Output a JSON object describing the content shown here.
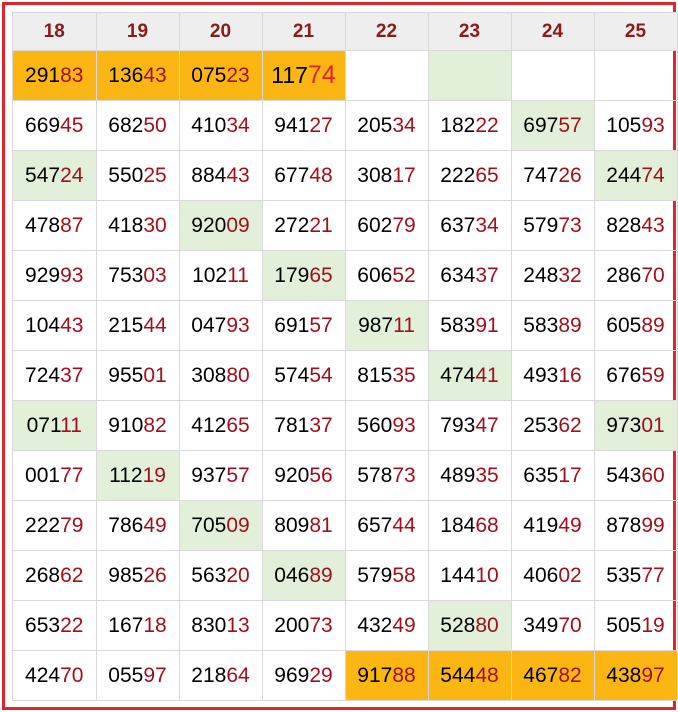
{
  "headers": [
    "18",
    "19",
    "20",
    "21",
    "22",
    "23",
    "24",
    "25"
  ],
  "colors": {
    "frame": "#e0242e",
    "header_text": "#8b1a1a",
    "highlight_green": "#e2f0d9",
    "highlight_orange": "#fbb614",
    "digits_tail": "#a0101c"
  },
  "rows": [
    [
      {
        "v": "29183",
        "bg": "orange"
      },
      {
        "v": "13643",
        "bg": "orange"
      },
      {
        "v": "07523",
        "bg": "orange"
      },
      {
        "v": "11774",
        "bg": "orange",
        "emph": true
      },
      {
        "v": "",
        "bg": ""
      },
      {
        "v": "",
        "bg": "green"
      },
      {
        "v": "",
        "bg": ""
      },
      {
        "v": "",
        "bg": ""
      }
    ],
    [
      {
        "v": "66945",
        "bg": ""
      },
      {
        "v": "68250",
        "bg": ""
      },
      {
        "v": "41034",
        "bg": ""
      },
      {
        "v": "94127",
        "bg": ""
      },
      {
        "v": "20534",
        "bg": ""
      },
      {
        "v": "18222",
        "bg": ""
      },
      {
        "v": "69757",
        "bg": "green"
      },
      {
        "v": "10593",
        "bg": ""
      }
    ],
    [
      {
        "v": "54724",
        "bg": "green"
      },
      {
        "v": "55025",
        "bg": ""
      },
      {
        "v": "88443",
        "bg": ""
      },
      {
        "v": "67748",
        "bg": ""
      },
      {
        "v": "30817",
        "bg": ""
      },
      {
        "v": "22265",
        "bg": ""
      },
      {
        "v": "74726",
        "bg": ""
      },
      {
        "v": "24474",
        "bg": "green"
      }
    ],
    [
      {
        "v": "47887",
        "bg": ""
      },
      {
        "v": "41830",
        "bg": ""
      },
      {
        "v": "92009",
        "bg": "green"
      },
      {
        "v": "27221",
        "bg": ""
      },
      {
        "v": "60279",
        "bg": ""
      },
      {
        "v": "63734",
        "bg": ""
      },
      {
        "v": "57973",
        "bg": ""
      },
      {
        "v": "82843",
        "bg": ""
      }
    ],
    [
      {
        "v": "92993",
        "bg": ""
      },
      {
        "v": "75303",
        "bg": ""
      },
      {
        "v": "10211",
        "bg": ""
      },
      {
        "v": "17965",
        "bg": "green"
      },
      {
        "v": "60652",
        "bg": ""
      },
      {
        "v": "63437",
        "bg": ""
      },
      {
        "v": "24832",
        "bg": ""
      },
      {
        "v": "28670",
        "bg": ""
      }
    ],
    [
      {
        "v": "10443",
        "bg": ""
      },
      {
        "v": "21544",
        "bg": ""
      },
      {
        "v": "04793",
        "bg": ""
      },
      {
        "v": "69157",
        "bg": ""
      },
      {
        "v": "98711",
        "bg": "green"
      },
      {
        "v": "58391",
        "bg": ""
      },
      {
        "v": "58389",
        "bg": ""
      },
      {
        "v": "60589",
        "bg": ""
      }
    ],
    [
      {
        "v": "72437",
        "bg": ""
      },
      {
        "v": "95501",
        "bg": ""
      },
      {
        "v": "30880",
        "bg": ""
      },
      {
        "v": "57454",
        "bg": ""
      },
      {
        "v": "81535",
        "bg": ""
      },
      {
        "v": "47441",
        "bg": "green"
      },
      {
        "v": "49316",
        "bg": ""
      },
      {
        "v": "67659",
        "bg": ""
      }
    ],
    [
      {
        "v": "07111",
        "bg": "green"
      },
      {
        "v": "91082",
        "bg": ""
      },
      {
        "v": "41265",
        "bg": ""
      },
      {
        "v": "78137",
        "bg": ""
      },
      {
        "v": "56093",
        "bg": ""
      },
      {
        "v": "79347",
        "bg": ""
      },
      {
        "v": "25362",
        "bg": ""
      },
      {
        "v": "97301",
        "bg": "green"
      }
    ],
    [
      {
        "v": "00177",
        "bg": ""
      },
      {
        "v": "11219",
        "bg": "green"
      },
      {
        "v": "93757",
        "bg": ""
      },
      {
        "v": "92056",
        "bg": ""
      },
      {
        "v": "57873",
        "bg": ""
      },
      {
        "v": "48935",
        "bg": ""
      },
      {
        "v": "63517",
        "bg": ""
      },
      {
        "v": "54360",
        "bg": ""
      }
    ],
    [
      {
        "v": "22279",
        "bg": ""
      },
      {
        "v": "78649",
        "bg": ""
      },
      {
        "v": "70509",
        "bg": "green"
      },
      {
        "v": "80981",
        "bg": ""
      },
      {
        "v": "65744",
        "bg": ""
      },
      {
        "v": "18468",
        "bg": ""
      },
      {
        "v": "41949",
        "bg": ""
      },
      {
        "v": "87899",
        "bg": ""
      }
    ],
    [
      {
        "v": "26862",
        "bg": ""
      },
      {
        "v": "98526",
        "bg": ""
      },
      {
        "v": "56320",
        "bg": ""
      },
      {
        "v": "04689",
        "bg": "green"
      },
      {
        "v": "57958",
        "bg": ""
      },
      {
        "v": "14410",
        "bg": ""
      },
      {
        "v": "40602",
        "bg": ""
      },
      {
        "v": "53577",
        "bg": ""
      }
    ],
    [
      {
        "v": "65322",
        "bg": ""
      },
      {
        "v": "16718",
        "bg": ""
      },
      {
        "v": "83013",
        "bg": ""
      },
      {
        "v": "20073",
        "bg": ""
      },
      {
        "v": "43249",
        "bg": ""
      },
      {
        "v": "52880",
        "bg": "green"
      },
      {
        "v": "34970",
        "bg": ""
      },
      {
        "v": "50519",
        "bg": ""
      }
    ],
    [
      {
        "v": "42470",
        "bg": ""
      },
      {
        "v": "05597",
        "bg": ""
      },
      {
        "v": "21864",
        "bg": ""
      },
      {
        "v": "96929",
        "bg": ""
      },
      {
        "v": "91788",
        "bg": "orange"
      },
      {
        "v": "54448",
        "bg": "orange"
      },
      {
        "v": "46782",
        "bg": "orange"
      },
      {
        "v": "43897",
        "bg": "orange"
      }
    ]
  ]
}
